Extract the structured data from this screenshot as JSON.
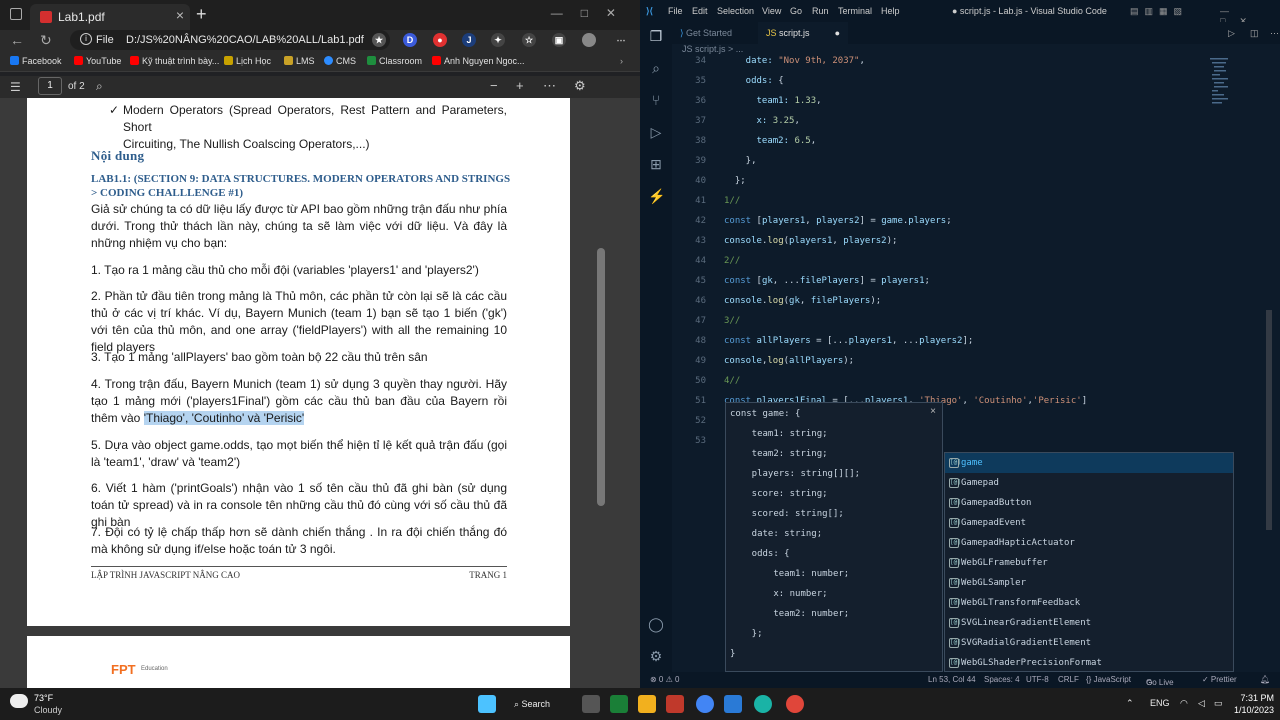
{
  "browser": {
    "tab_title": "Lab1.pdf",
    "url_label": "File",
    "url": "D:/JS%20NÂNG%20CAO/LAB%20ALL/Lab1.pdf",
    "bookmarks": [
      "Facebook",
      "YouTube",
      "Kỹ thuật trình bày...",
      "Lịch Học",
      "LMS",
      "CMS",
      "Classroom",
      "Anh Nguyen Ngoc..."
    ],
    "page_number": "1",
    "page_total": "of 2",
    "extensions": [
      "D",
      "J"
    ]
  },
  "document": {
    "bullet_line1": "Modern Operators (Spread Operators, Rest Pattern and Parameters, Short",
    "bullet_line2": "Circuiting, The Nullish Coalscing Operators,...)",
    "heading_content": "Nội dung",
    "lab_heading": "Lab1.1: (section 9: data structures. modern operators and strings > Coding Challlenge #1)",
    "intro": "Giả sử chúng ta có dữ liệu lấy được từ API bao gồm những trận đấu như phía dưới. Trong  thử thách lần này, chúng ta sẽ làm việc với dữ liệu. Và đây là những nhiệm vụ cho bạn:",
    "task1": "1. Tạo ra 1 mảng cầu thủ cho mỗi đội (variables 'players1' and 'players2')",
    "task2": "2. Phần tử đầu tiên trong mảng là Thủ môn, các phần tử còn lại sẽ là các cầu thủ ở các vị trí khác. Ví dụ, Bayern Munich (team 1) bạn sẽ tạo 1 biến ('gk') với tên của thủ môn, and one array ('fieldPlayers') with all the remaining 10 field players",
    "task3": "3. Tạo 1 mảng 'allPlayers' bao gồm toàn bộ 22 cầu thủ trên sân",
    "task4": "4. Trong trận đấu, Bayern Munich (team 1) sử dụng 3 quyền thay người. Hãy tạo 1 mảng mới ('players1Final') gồm các cầu thủ ban đầu của Bayern rồi thêm vào",
    "task4_highlight": "'Thiago', 'Coutinho' và 'Perisic'",
    "task5": "5. Dựa vào object game.odds, tạo mọt biến thể hiện tỉ lệ kết quả trận đấu (gọi là 'team1', 'draw' và 'team2')",
    "task6": "6. Viết 1 hàm ('printGoals') nhận vào 1 số tên cầu thủ đã ghi bàn (sử dụng toán tử spread) và in ra console tên những cầu thủ đó cùng với số cầu thủ đã ghi bàn",
    "task7": "7. Đội có tỷ lệ chấp thấp hơn sẽ dành chiến thắng . In ra đội chiến thắng đó mà không sử dụng if/else hoặc toán tử 3 ngôi.",
    "footer_left": "Lập trình javascript nâng cao",
    "footer_right": "Trang 1",
    "page2_logo": "FPT",
    "page2_logo_sub": "Education"
  },
  "vscode": {
    "menu": [
      "File",
      "Edit",
      "Selection",
      "View",
      "Go",
      "Run",
      "Terminal",
      "Help"
    ],
    "title": "● script.js - Lab.js - Visual Studio Code",
    "tab_inactive": "Get Started",
    "tab_active": "script.js",
    "breadcrumb": "JS script.js > ...",
    "lines": [
      {
        "n": "34",
        "c": [
          [
            "pr",
            "    date: "
          ],
          [
            "st",
            "\"Nov 9th, 2037\""
          ],
          [
            "",
            ","
          ]
        ]
      },
      {
        "n": "35",
        "c": [
          [
            "pr",
            "    odds: "
          ],
          [
            "",
            "{"
          ]
        ]
      },
      {
        "n": "36",
        "c": [
          [
            "pr",
            "      team1: "
          ],
          [
            "nm",
            "1.33"
          ],
          [
            "",
            ","
          ]
        ]
      },
      {
        "n": "37",
        "c": [
          [
            "pr",
            "      x: "
          ],
          [
            "nm",
            "3.25"
          ],
          [
            "",
            ","
          ]
        ]
      },
      {
        "n": "38",
        "c": [
          [
            "pr",
            "      team2: "
          ],
          [
            "nm",
            "6.5"
          ],
          [
            "",
            ","
          ]
        ]
      },
      {
        "n": "39",
        "c": [
          [
            "",
            "    },"
          ]
        ]
      },
      {
        "n": "40",
        "c": [
          [
            "",
            "  };"
          ]
        ]
      },
      {
        "n": "41",
        "c": [
          [
            "cm",
            "1//"
          ]
        ]
      },
      {
        "n": "42",
        "c": [
          [
            "kw",
            "const "
          ],
          [
            "",
            "["
          ],
          [
            "pr",
            "players1"
          ],
          [
            "",
            ", "
          ],
          [
            "pr",
            "players2"
          ],
          [
            "",
            "] = "
          ],
          [
            "pr",
            "game"
          ],
          [
            "",
            "."
          ],
          [
            "pr",
            "players"
          ],
          [
            "",
            ";"
          ]
        ]
      },
      {
        "n": "43",
        "c": [
          [
            "pr",
            "console"
          ],
          [
            "",
            "."
          ],
          [
            "fn",
            "log"
          ],
          [
            "",
            "("
          ],
          [
            "pr",
            "players1"
          ],
          [
            "",
            ", "
          ],
          [
            "pr",
            "players2"
          ],
          [
            "",
            ");"
          ]
        ]
      },
      {
        "n": "44",
        "c": [
          [
            "cm",
            "2//"
          ]
        ]
      },
      {
        "n": "45",
        "c": [
          [
            "kw",
            "const "
          ],
          [
            "",
            "["
          ],
          [
            "pr",
            "gk"
          ],
          [
            "",
            ", ..."
          ],
          [
            "pr",
            "filePlayers"
          ],
          [
            "",
            "] = "
          ],
          [
            "pr",
            "players1"
          ],
          [
            "",
            ";"
          ]
        ]
      },
      {
        "n": "46",
        "c": [
          [
            "pr",
            "console"
          ],
          [
            "",
            "."
          ],
          [
            "fn",
            "log"
          ],
          [
            "",
            "("
          ],
          [
            "pr",
            "gk"
          ],
          [
            "",
            ", "
          ],
          [
            "pr",
            "filePlayers"
          ],
          [
            "",
            ");"
          ]
        ]
      },
      {
        "n": "47",
        "c": [
          [
            "cm",
            "3//"
          ]
        ]
      },
      {
        "n": "48",
        "c": [
          [
            "kw",
            "const "
          ],
          [
            "pr",
            "allPlayers"
          ],
          [
            "",
            " = [..."
          ],
          [
            "pr",
            "players1"
          ],
          [
            "",
            ", ..."
          ],
          [
            "pr",
            "players2"
          ],
          [
            "",
            "];"
          ]
        ]
      },
      {
        "n": "49",
        "c": [
          [
            "pr",
            "console"
          ],
          [
            "",
            ","
          ],
          [
            "fn",
            "log"
          ],
          [
            "",
            "("
          ],
          [
            "pr",
            "allPlayers"
          ],
          [
            "",
            ");"
          ]
        ]
      },
      {
        "n": "50",
        "c": [
          [
            "cm",
            "4//"
          ]
        ]
      },
      {
        "n": "51",
        "c": [
          [
            "kw",
            "const "
          ],
          [
            "pr",
            "players1Final"
          ],
          [
            "",
            " = [..."
          ],
          [
            "pr",
            "players1"
          ],
          [
            "",
            ", "
          ],
          [
            "st",
            "'Thiago'"
          ],
          [
            "",
            ", "
          ],
          [
            "st",
            "'Coutinho'"
          ],
          [
            "",
            ","
          ],
          [
            "st",
            "'Perisic'"
          ],
          [
            "",
            "]"
          ]
        ]
      },
      {
        "n": "52",
        "c": [
          [
            "",
            ""
          ]
        ]
      },
      {
        "n": "53",
        "c": [
          [
            "",
            ""
          ]
        ]
      }
    ],
    "hover_lines": [
      "const game: {",
      "    team1: string;",
      "    team2: string;",
      "    players: string[][];",
      "    score: string;",
      "    scored: string[];",
      "    date: string;",
      "    odds: {",
      "        team1: number;",
      "        x: number;",
      "        team2: number;",
      "    };",
      "}"
    ],
    "suggestions": [
      "game",
      "Gamepad",
      "GamepadButton",
      "GamepadEvent",
      "GamepadHapticActuator",
      "WebGLFramebuffer",
      "WebGLSampler",
      "WebGLTransformFeedback",
      "SVGLinearGradientElement",
      "SVGRadialGradientElement",
      "WebGLShaderPrecisionFormat"
    ],
    "status": {
      "errors": "⊗ 0 ⚠ 0",
      "position": "Ln 53, Col 44",
      "spaces": "Spaces: 4",
      "encoding": "UTF-8",
      "eol": "CRLF",
      "language": "{} JavaScript",
      "golive": "Go Live",
      "prettier": "✓ Prettier"
    }
  },
  "taskbar": {
    "weather_temp": "73°F",
    "weather_desc": "Cloudy",
    "search_label": "Search",
    "language": "ENG",
    "time": "7:31 PM",
    "date": "1/10/2023"
  }
}
